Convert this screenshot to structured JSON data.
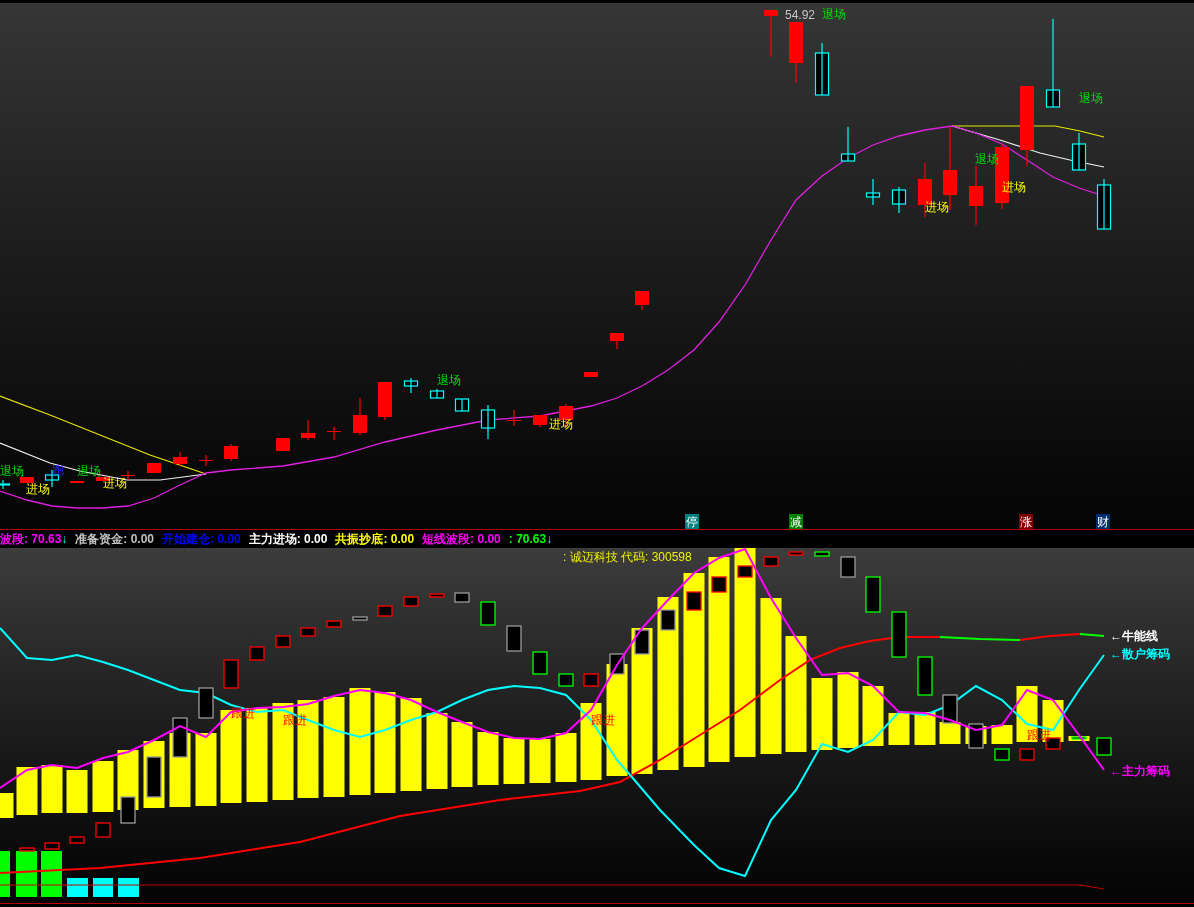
{
  "price_panel": {
    "price_label": "54.92",
    "signals": [
      {
        "text": "退场",
        "kind": "exit"
      },
      {
        "text": "退场",
        "kind": "exit"
      },
      {
        "text": "退场",
        "kind": "exit"
      },
      {
        "text": "进场",
        "kind": "entry"
      },
      {
        "text": "进场",
        "kind": "entry"
      },
      {
        "text": "退场",
        "kind": "exit"
      },
      {
        "text": "进场",
        "kind": "entry"
      },
      {
        "text": "退场",
        "kind": "exit"
      },
      {
        "text": "跑",
        "kind": "escape"
      },
      {
        "text": "退场",
        "kind": "exit"
      },
      {
        "text": "进场",
        "kind": "entry"
      },
      {
        "text": "进场",
        "kind": "entry"
      }
    ],
    "tags": [
      {
        "text": "停",
        "color": "#008080"
      },
      {
        "text": "减",
        "color": "#008000"
      },
      {
        "text": "涨",
        "color": "#800000"
      },
      {
        "text": "财",
        "color": "#003070"
      }
    ]
  },
  "readings": [
    {
      "text": "波段: 70.63",
      "arrow": "↓",
      "color": "#ff00ff"
    },
    {
      "text": "准备资金: 0.00",
      "color": "#c0c0c0"
    },
    {
      "text": "开始建仓: 0.00",
      "color": "#0000ff"
    },
    {
      "text": "主力进场: 0.00",
      "color": "#ffffff"
    },
    {
      "text": "共振抄底: 0.00",
      "color": "#ffff00"
    },
    {
      "text": "短线波段: 0.00",
      "color": "#ff00ff"
    },
    {
      "text": ": 70.63",
      "arrow": "↓",
      "color": "#00ff00"
    }
  ],
  "indicator_panel": {
    "title": ": 诚迈科技 代码: 300598",
    "signals": [
      {
        "text": "跟进"
      },
      {
        "text": "跟进"
      },
      {
        "text": "跟进"
      },
      {
        "text": "跟进"
      }
    ],
    "legend": [
      {
        "text": "←牛能线",
        "color": "#ffffff"
      },
      {
        "text": "←散户筹码",
        "color": "#00ffff"
      },
      {
        "text": "←主力筹码",
        "color": "#ff00ff"
      }
    ]
  }
}
